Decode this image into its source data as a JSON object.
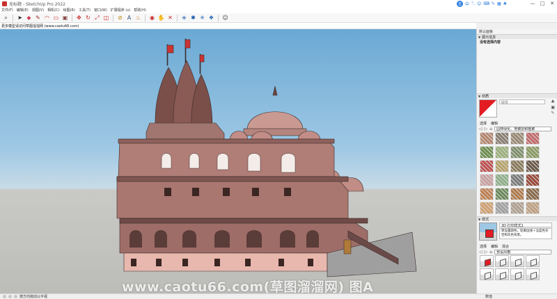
{
  "titlebar": {
    "title": "无标题 - SketchUp Pro 2022",
    "window_buttons": [
      "—",
      "□",
      "✕"
    ]
  },
  "ime": {
    "logo": "王",
    "items": [
      "中",
      "°,",
      "☺",
      "⌨",
      "✎",
      "▦",
      "♣"
    ]
  },
  "menus": [
    "文件(F)",
    "编辑(E)",
    "视图(V)",
    "相机(C)",
    "绘图(R)",
    "工具(T)",
    "窗口(W)",
    "扩展程序 (x)",
    "帮助(H)"
  ],
  "toolbar": {
    "icons": [
      "search-icon",
      "select-arrow-icon",
      "eraser-icon",
      "pencil-line-icon",
      "arc-icon",
      "rectangle-icon",
      "pushpull-icon",
      "move-icon",
      "rotate-icon",
      "scale-icon",
      "offset-icon",
      "tape-measure-icon",
      "text-icon",
      "paint-bucket-icon",
      "orbit-icon",
      "pan-icon",
      "zoom-extents-icon",
      "warehouse-icon",
      "extension-warehouse-icon",
      "layout-icon",
      "share-icon",
      "user-icon"
    ]
  },
  "hint": "更多模型请访问草图溜溜网 (www.caotu66.com)",
  "viewport": {
    "watermark": "www.caotu66.com(草图溜溜网) 图A",
    "sky_color": "#6aa9d4",
    "ground_color": "#bcbcb8"
  },
  "status": {
    "message": "按方向拖动以平视",
    "vcb_label": "数值"
  },
  "panel": {
    "tray_title": "默认面板",
    "entity_info": {
      "header": "图元信息",
      "text": "没有选择内容"
    },
    "materials": {
      "header": "材质",
      "name_placeholder": "缺省",
      "tabs": [
        "选择",
        "编辑"
      ],
      "library": "园林绿化、地被层和植被",
      "swatch_colors": [
        "#b7876f",
        "#8a7f73",
        "#9a8a74",
        "#c46a6a",
        "#6d8f4e",
        "#9bb07a",
        "#7f8f6a",
        "#8a9b62",
        "#c05050",
        "#b8a36a",
        "#8a7a5a",
        "#6a5a4a",
        "#caa0a0",
        "#8fb08a",
        "#7a7a7a",
        "#9a4a3a",
        "#c08050",
        "#6a8a5a",
        "#b07a4a",
        "#8a6a4a",
        "#d0a070",
        "#a0a0a0",
        "#b0a090",
        "#c0a080"
      ]
    },
    "styles": {
      "header": "样式",
      "name": "3D 打印样式1",
      "description": "转设置颜色，轮廓边线＋淡蓝色天空和灰色背景。",
      "tabs": [
        "选择",
        "编辑",
        "混合"
      ],
      "collection": "预设风格"
    }
  }
}
